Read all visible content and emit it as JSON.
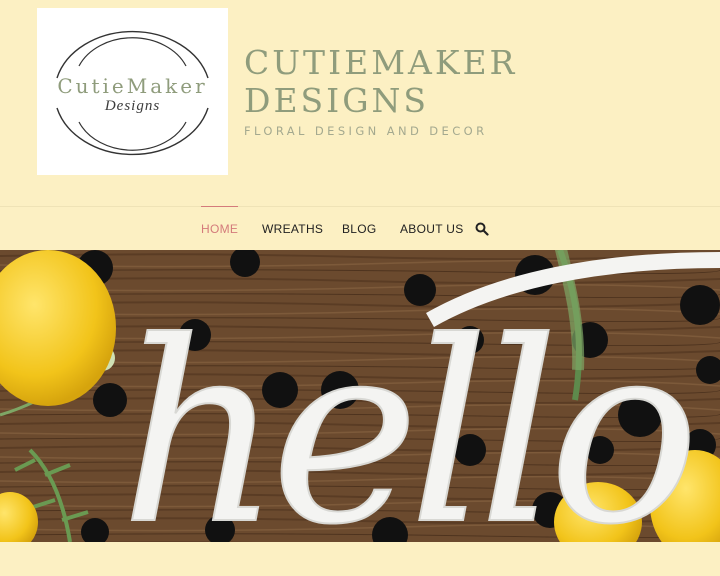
{
  "logo": {
    "main_text": "CutieMaker",
    "script_text": "Designs"
  },
  "site": {
    "title_line1": "CUTIEMAKER",
    "title_line2": "DESIGNS",
    "tagline": "FLORAL DESIGN AND DECOR"
  },
  "nav": {
    "home": "HOME",
    "wreaths": "WREATHS",
    "blog": "BLOG",
    "about": "ABOUT US"
  },
  "hero": {
    "sign_text": "hello"
  },
  "colors": {
    "background": "#fcf0c3",
    "title_green": "#8f9c7c",
    "nav_active": "#d47b7b",
    "wood": "#6b4a2e"
  }
}
